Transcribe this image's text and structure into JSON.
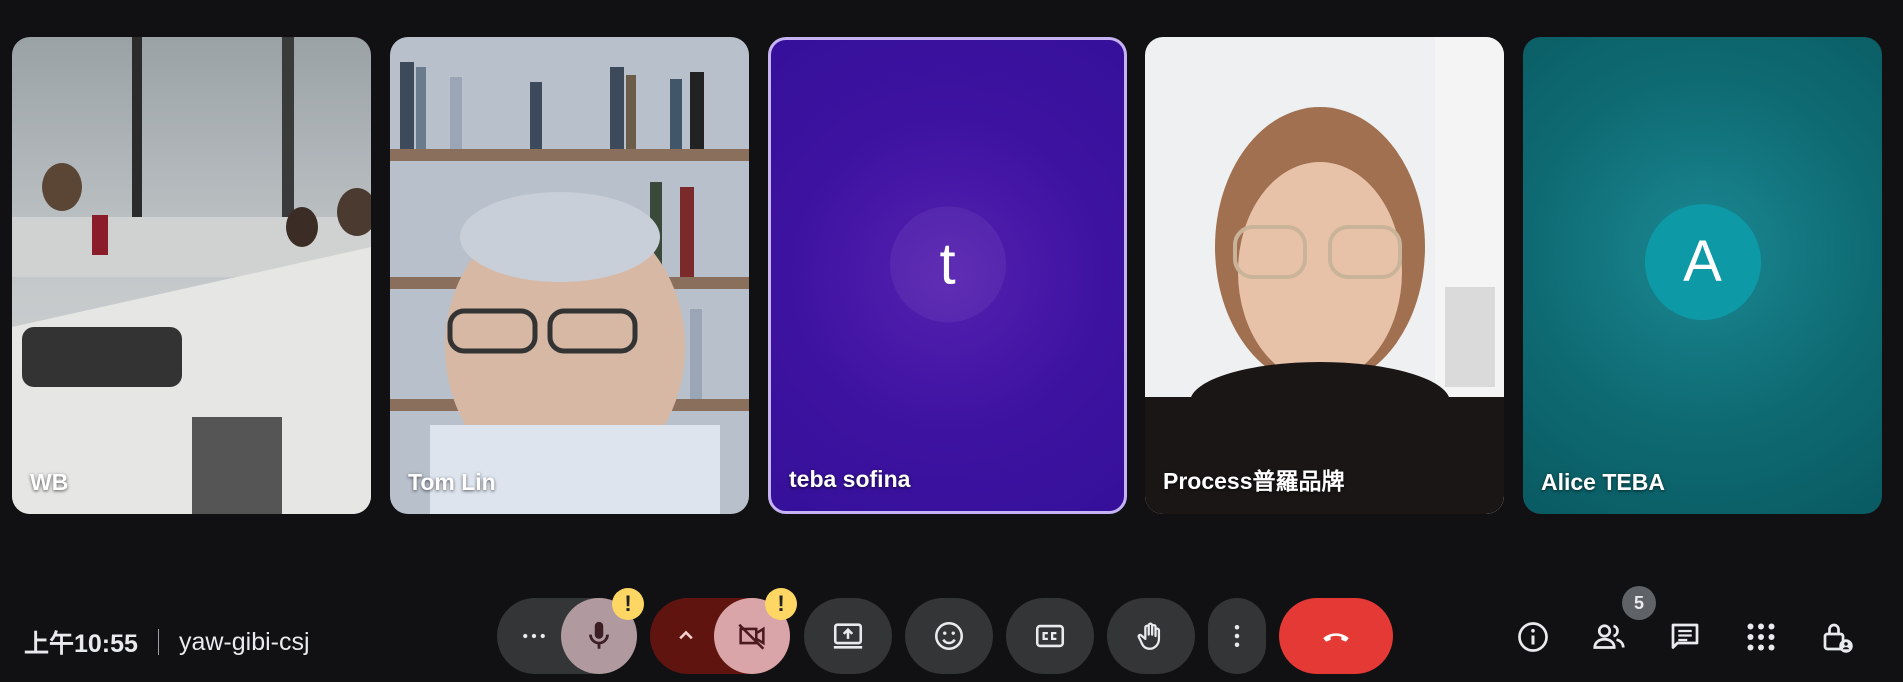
{
  "participants": [
    {
      "name": "WB"
    },
    {
      "name": "Tom Lin"
    },
    {
      "name": "teba sofina",
      "avatar_letter": "t"
    },
    {
      "name": "Process普羅品牌"
    },
    {
      "name": "Alice TEBA",
      "avatar_letter": "A"
    }
  ],
  "meeting": {
    "time": "上午10:55",
    "code": "yaw-gibi-csj"
  },
  "controls": {
    "warning_mark": "!"
  },
  "people_count": "5",
  "colors": {
    "background": "#111113",
    "control_bg": "#333537",
    "end_call": "#e53935",
    "mic_muted": "#b09aa0",
    "cam_off": "#d9a5a8",
    "warning": "#fdd663",
    "active_speaker_border": "#c6b3f5"
  },
  "icons": [
    "more-horizontal-icon",
    "mic-off-icon",
    "chevron-up-icon",
    "camera-off-icon",
    "present-screen-icon",
    "emoji-icon",
    "captions-icon",
    "raise-hand-icon",
    "more-vertical-icon",
    "end-call-icon",
    "info-icon",
    "people-icon",
    "chat-icon",
    "apps-icon",
    "host-controls-icon"
  ]
}
